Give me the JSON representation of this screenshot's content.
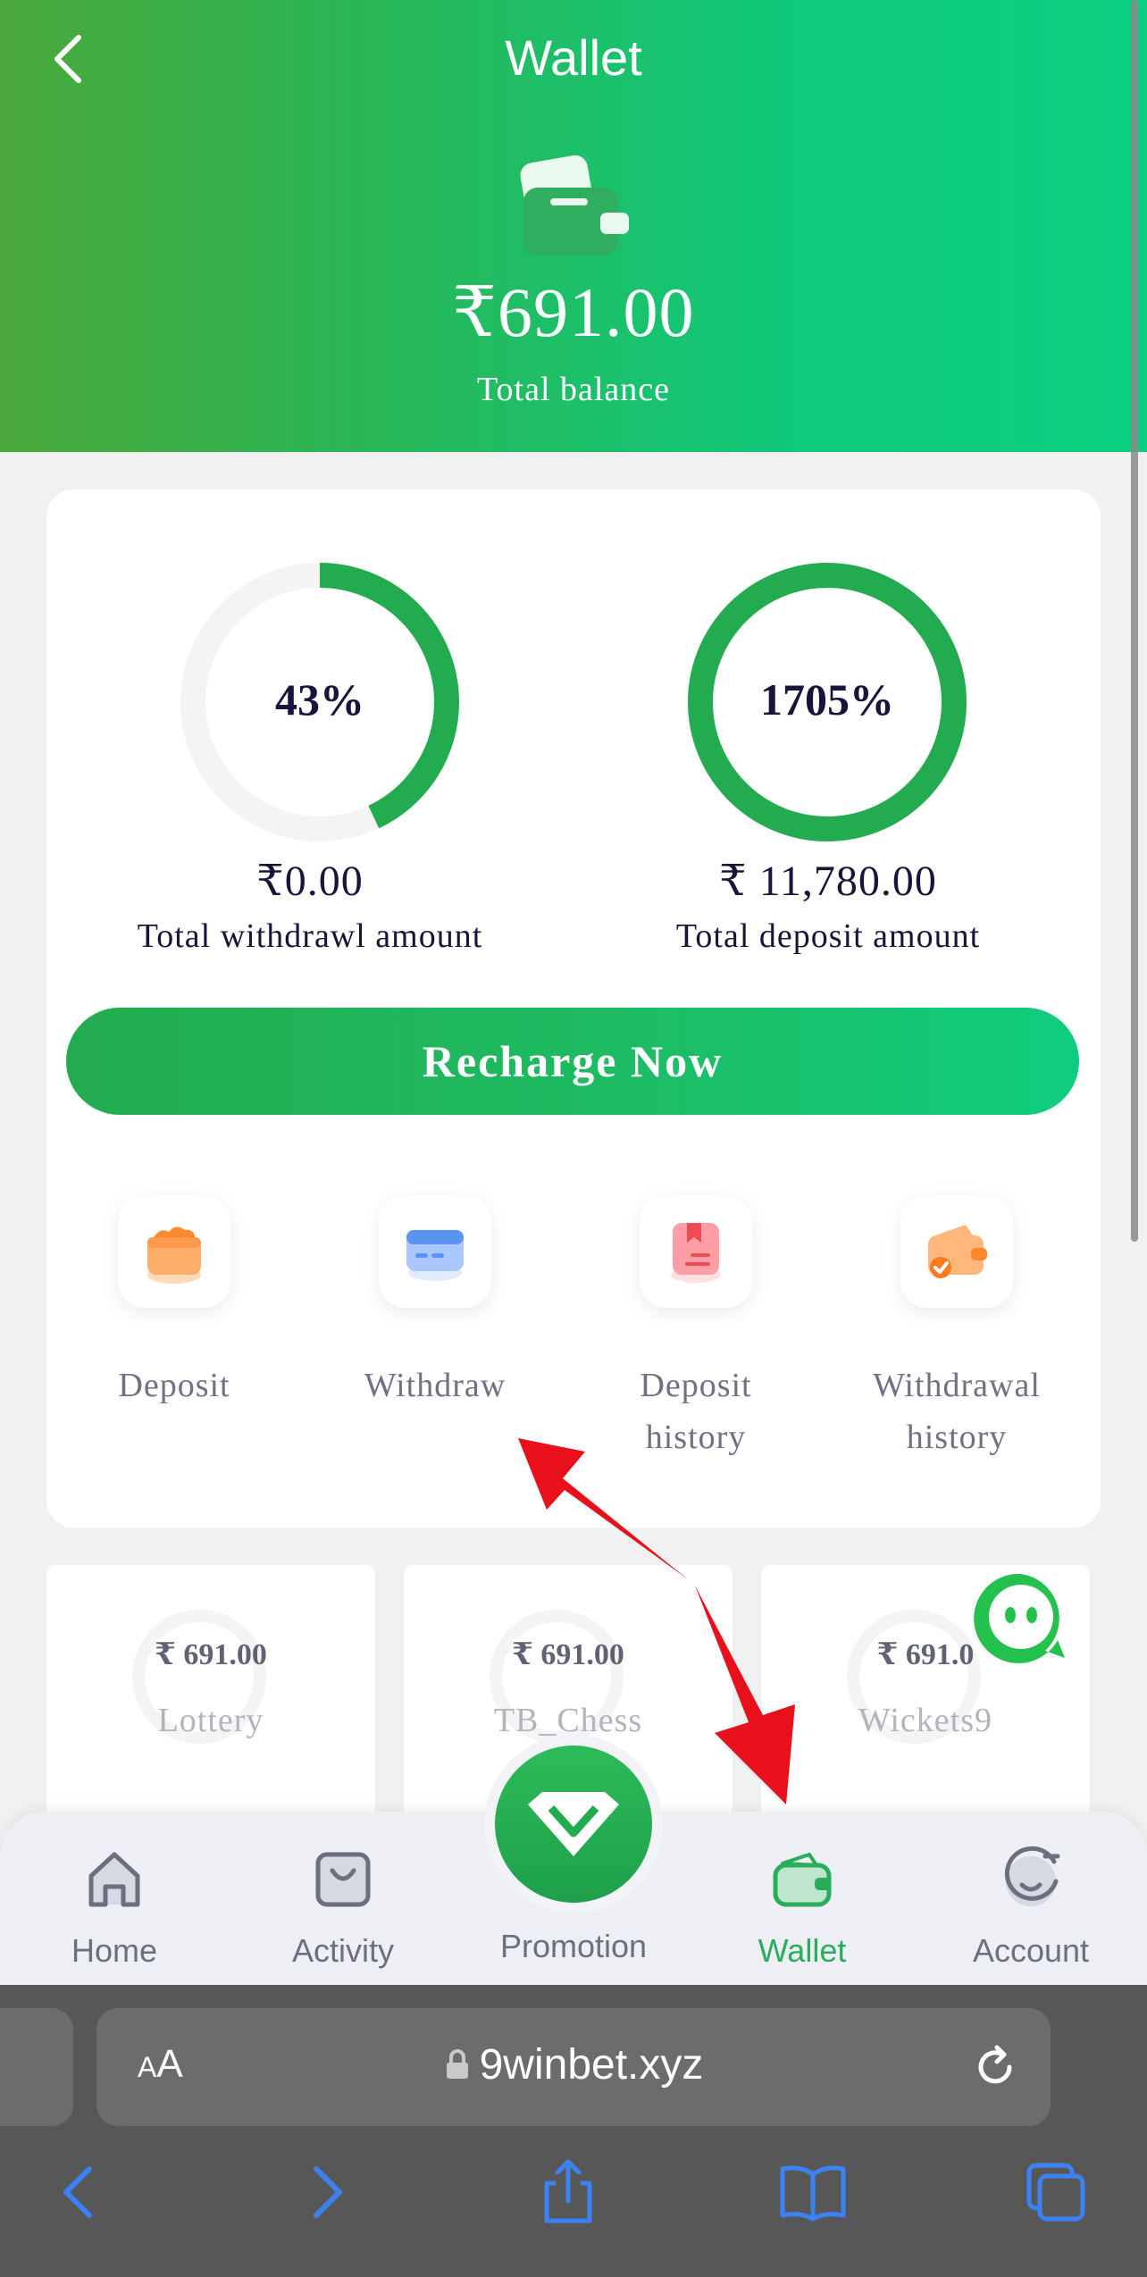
{
  "header": {
    "title": "Wallet",
    "balance": "₹691.00",
    "balance_label": "Total balance"
  },
  "stats": {
    "withdraw": {
      "percent_text": "43%",
      "percent_value": 43,
      "amount": "₹0.00",
      "label": "Total withdrawl amount"
    },
    "deposit": {
      "percent_text": "1705%",
      "percent_value": 1705,
      "amount": "₹ 11,780.00",
      "label": "Total deposit amount"
    }
  },
  "recharge_button": "Recharge Now",
  "actions": [
    {
      "label": "Deposit",
      "icon": "deposit-wallet-icon"
    },
    {
      "label": "Withdraw",
      "icon": "card-icon"
    },
    {
      "label": "Deposit history",
      "icon": "deposit-history-icon"
    },
    {
      "label": "Withdrawal history",
      "icon": "withdrawal-history-icon"
    }
  ],
  "games": [
    {
      "amount": "₹ 691.00",
      "name": "Lottery"
    },
    {
      "amount": "₹ 691.00",
      "name": "TB_Chess"
    },
    {
      "amount": "₹ 691.0",
      "name": "Wickets9"
    }
  ],
  "nav": {
    "items": [
      {
        "label": "Home",
        "icon": "home-icon"
      },
      {
        "label": "Activity",
        "icon": "activity-icon"
      },
      {
        "label": "Promotion",
        "icon": "diamond-icon"
      },
      {
        "label": "Wallet",
        "icon": "wallet-icon",
        "active": true
      },
      {
        "label": "Account",
        "icon": "account-icon"
      }
    ]
  },
  "browser": {
    "text_size_button": "AA",
    "url": "9winbet.xyz"
  },
  "colors": {
    "brand_green": "#23ac4f",
    "text_dark": "#15163a",
    "annotation_red": "#e8101a"
  }
}
